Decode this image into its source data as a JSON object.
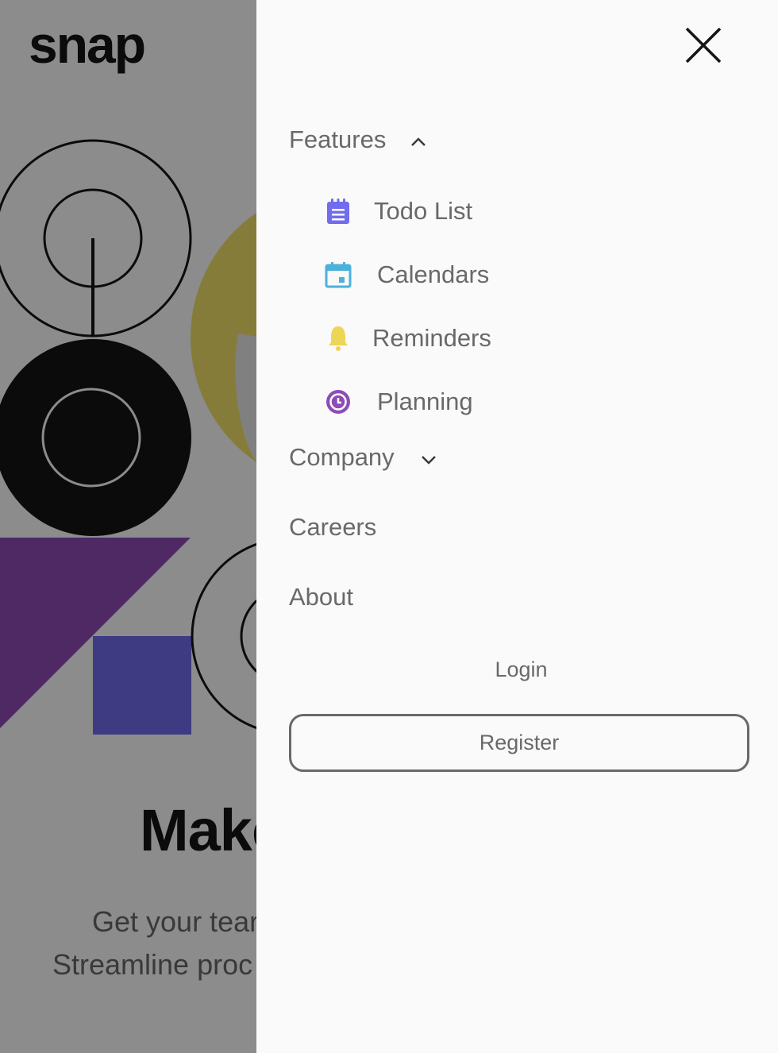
{
  "brand": {
    "logo_text": "snap"
  },
  "hero": {
    "title": "Make",
    "subtitle_line1": "Get your tear",
    "subtitle_line2": "Streamline proc"
  },
  "drawer": {
    "close_icon": "close-icon",
    "nav": {
      "features_label": "Features",
      "features_expanded": true,
      "features_items": [
        {
          "label": "Todo List",
          "icon": "todo-list-icon",
          "color": "#726CEE"
        },
        {
          "label": "Calendars",
          "icon": "calendar-icon",
          "color": "#4BB1DA"
        },
        {
          "label": "Reminders",
          "icon": "bell-icon",
          "color": "#EDD556"
        },
        {
          "label": "Planning",
          "icon": "clock-icon",
          "color": "#8E4CB6"
        }
      ],
      "company_label": "Company",
      "company_expanded": false,
      "careers_label": "Careers",
      "about_label": "About"
    },
    "login_label": "Login",
    "register_label": "Register"
  },
  "colors": {
    "text_gray": "#696969",
    "drawer_bg": "#fafafa",
    "dark": "#151515"
  }
}
